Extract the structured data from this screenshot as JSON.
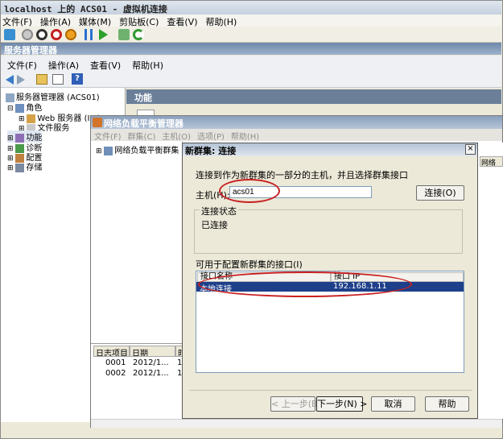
{
  "vm": {
    "title": "localhost 上的 ACS01 - 虚拟机连接",
    "menu": [
      "文件(F)",
      "操作(A)",
      "媒体(M)",
      "剪贴板(C)",
      "查看(V)",
      "帮助(H)"
    ]
  },
  "server_manager": {
    "title": "服务器管理器",
    "menu": [
      "文件(F)",
      "操作(A)",
      "查看(V)",
      "帮助(H)"
    ],
    "tree": {
      "root": "服务器管理器 (ACS01)",
      "roles": "角色",
      "web": "Web 服务器 (IIS)",
      "file": "文件服务",
      "features": "功能",
      "diagnostics": "诊断",
      "config": "配置",
      "storage": "存储"
    },
    "pane_header": "功能"
  },
  "nlb": {
    "title": "网络负载平衡管理器",
    "menu": [
      "文件(F)",
      "群集(C)",
      "主机(O)",
      "选项(P)",
      "帮助(H)"
    ],
    "tree_root": "网络负载平衡群集",
    "log": {
      "columns": [
        "日志项目",
        "日期",
        "时"
      ],
      "rows": [
        {
          "id": "0001",
          "date": "2012/1...",
          "t": "1"
        },
        {
          "id": "0002",
          "date": "2012/1...",
          "t": "1"
        }
      ]
    },
    "right_col_head": "网络"
  },
  "dialog": {
    "title": "新群集: 连接",
    "close": "×",
    "instruction": "连接到作为新群集的一部分的主机，并且选择群集接口",
    "host_label": "主机(H):",
    "host_value": "acs01",
    "connect_button": "连接(O)",
    "status_group_label": "连接状态",
    "status_value": "已连接",
    "iface_label": "可用于配置新群集的接口(I)",
    "iface_columns": [
      "接口名称",
      "接口 IP"
    ],
    "iface_rows": [
      {
        "name": "本地连接",
        "ip": "192.168.1.11"
      }
    ],
    "back_button": "< 上一步(B)",
    "next_button": "下一步(N) >",
    "cancel_button": "取消",
    "help_button": "帮助"
  }
}
